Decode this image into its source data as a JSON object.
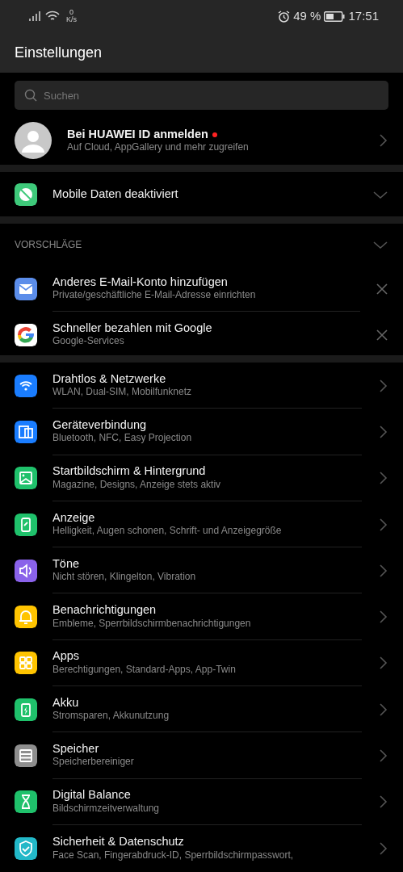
{
  "status_bar": {
    "speed_value": "0",
    "speed_unit": "K/s",
    "battery_percent": "49 %",
    "time": "17:51"
  },
  "header": {
    "title": "Einstellungen"
  },
  "search": {
    "placeholder": "Suchen"
  },
  "account": {
    "title": "Bei HUAWEI ID anmelden",
    "subtitle": "Auf Cloud, AppGallery und mehr zugreifen",
    "notification_dot": true
  },
  "mobile_data": {
    "title": "Mobile Daten deaktiviert",
    "expanded": false
  },
  "suggestions": {
    "heading": "VORSCHLÄGE",
    "expanded": false,
    "items": [
      {
        "kind": "mail",
        "color": "#5b8dea",
        "title": "Anderes E-Mail-Konto hinzufügen",
        "subtitle": "Private/geschäftliche E-Mail-Adresse einrichten"
      },
      {
        "kind": "google",
        "color": "#ffffff",
        "title": "Schneller bezahlen mit Google",
        "subtitle": "Google-Services"
      }
    ]
  },
  "settings": [
    {
      "kind": "wifi",
      "color": "#1a7dff",
      "title": "Drahtlos & Netzwerke",
      "subtitle": "WLAN, Dual-SIM, Mobilfunknetz"
    },
    {
      "kind": "devices",
      "color": "#1a7dff",
      "title": "Geräteverbindung",
      "subtitle": "Bluetooth, NFC, Easy Projection"
    },
    {
      "kind": "image",
      "color": "#1fc16b",
      "title": "Startbildschirm & Hintergrund",
      "subtitle": "Magazine, Designs, Anzeige stets aktiv"
    },
    {
      "kind": "phone",
      "color": "#1fc16b",
      "title": "Anzeige",
      "subtitle": "Helligkeit, Augen schonen, Schrift- und Anzeigegröße"
    },
    {
      "kind": "sound",
      "color": "#8a62ea",
      "title": "Töne",
      "subtitle": "Nicht stören, Klingelton, Vibration"
    },
    {
      "kind": "bell",
      "color": "#ffc400",
      "title": "Benachrichtigungen",
      "subtitle": "Embleme, Sperrbildschirmbenachrichtigungen"
    },
    {
      "kind": "grid",
      "color": "#ffc400",
      "title": "Apps",
      "subtitle": "Berechtigungen, Standard-Apps, App-Twin"
    },
    {
      "kind": "battery",
      "color": "#1fc16b",
      "title": "Akku",
      "subtitle": "Stromsparen, Akkunutzung"
    },
    {
      "kind": "storage",
      "color": "#8e8e8e",
      "title": "Speicher",
      "subtitle": "Speicherbereiniger"
    },
    {
      "kind": "hourglass",
      "color": "#1fc16b",
      "title": "Digital Balance",
      "subtitle": "Bildschirmzeitverwaltung"
    },
    {
      "kind": "shield",
      "color": "#22b8c8",
      "title": "Sicherheit & Datenschutz",
      "subtitle": "Face Scan, Fingerabdruck-ID, Sperrbildschirmpasswort,"
    }
  ]
}
